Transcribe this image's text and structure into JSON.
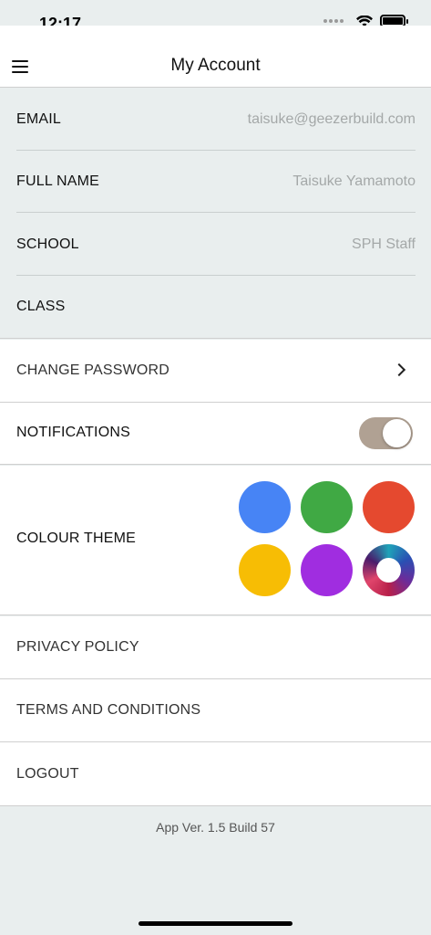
{
  "status_bar": {
    "time": "12:17"
  },
  "header": {
    "title": "My Account"
  },
  "account": {
    "email_label": "EMAIL",
    "email_value": "taisuke@geezerbuild.com",
    "name_label": "FULL NAME",
    "name_value": "Taisuke Yamamoto",
    "school_label": "SCHOOL",
    "school_value": "SPH Staff",
    "class_label": "CLASS",
    "class_value": ""
  },
  "settings": {
    "change_password": "CHANGE PASSWORD",
    "notifications": "NOTIFICATIONS",
    "notifications_on": true,
    "colour_theme": "COLOUR THEME",
    "privacy_policy": "PRIVACY POLICY",
    "terms": "TERMS AND CONDITIONS",
    "logout": "LOGOUT"
  },
  "theme_colors": {
    "blue": "#4784f5",
    "green": "#40a944",
    "red": "#e5492f",
    "yellow": "#f7bd04",
    "purple": "#a02de0",
    "custom_icon": "gradient-ring-icon"
  },
  "toggle_color": "#b0a193",
  "footer": {
    "version": "App Ver. 1.5 Build 57"
  }
}
